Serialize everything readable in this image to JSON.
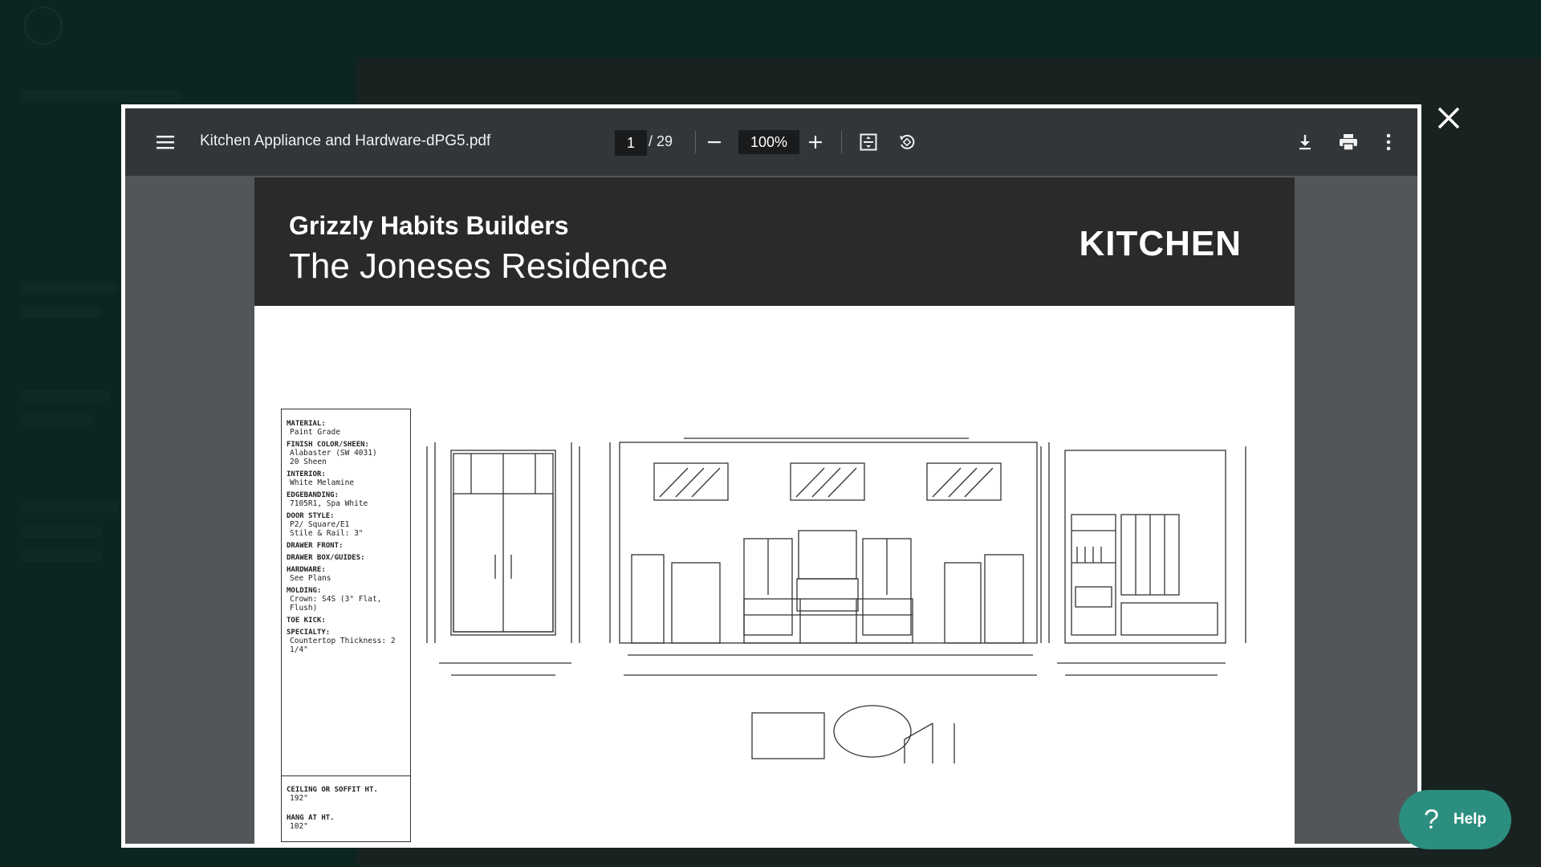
{
  "viewer": {
    "file_name": "Kitchen Appliance and Hardware-dPG5.pdf",
    "page_current": "1",
    "page_total": "/ 29",
    "zoom": "100%"
  },
  "document": {
    "company": "Grizzly Habits Builders",
    "residence": "The Joneses Residence",
    "room": "KITCHEN",
    "spec": {
      "items": [
        {
          "label": "MATERIAL:",
          "value": "Paint Grade"
        },
        {
          "label": "FINISH COLOR/SHEEN:",
          "value": "Alabaster (SW 4031)"
        },
        {
          "label": "",
          "value": "20 Sheen"
        },
        {
          "label": "INTERIOR:",
          "value": "White Melamine"
        },
        {
          "label": "EDGEBANDING:",
          "value": "7105R1, Spa White"
        },
        {
          "label": "DOOR STYLE:",
          "value": "P2/ Square/E1"
        },
        {
          "label": "",
          "value": "Stile & Rail: 3\""
        },
        {
          "label": "DRAWER FRONT:",
          "value": ""
        },
        {
          "label": "DRAWER BOX/GUIDES:",
          "value": ""
        },
        {
          "label": "HARDWARE:",
          "value": "See Plans"
        },
        {
          "label": "MOLDING:",
          "value": "Crown: S4S (3\" Flat, Flush)"
        },
        {
          "label": "TOE KICK:",
          "value": ""
        },
        {
          "label": "SPECIALTY:",
          "value": "Countertop Thickness: 2 1/4\""
        }
      ],
      "ceiling_label": "CEILING OR SOFFIT HT.",
      "ceiling_value": "192\"",
      "hang_label": "HANG AT HT.",
      "hang_value": "102\""
    }
  },
  "help": {
    "label": "Help"
  },
  "icons": [
    "menu-icon",
    "minus-icon",
    "plus-icon",
    "fit-page-icon",
    "rotate-icon",
    "download-icon",
    "print-icon",
    "more-vert-icon",
    "close-icon",
    "help-icon"
  ],
  "colors": {
    "toolbar": "#323639",
    "viewer_bg": "#525659",
    "banner": "#2a2a2a",
    "help_button": "#2c8e7e"
  }
}
